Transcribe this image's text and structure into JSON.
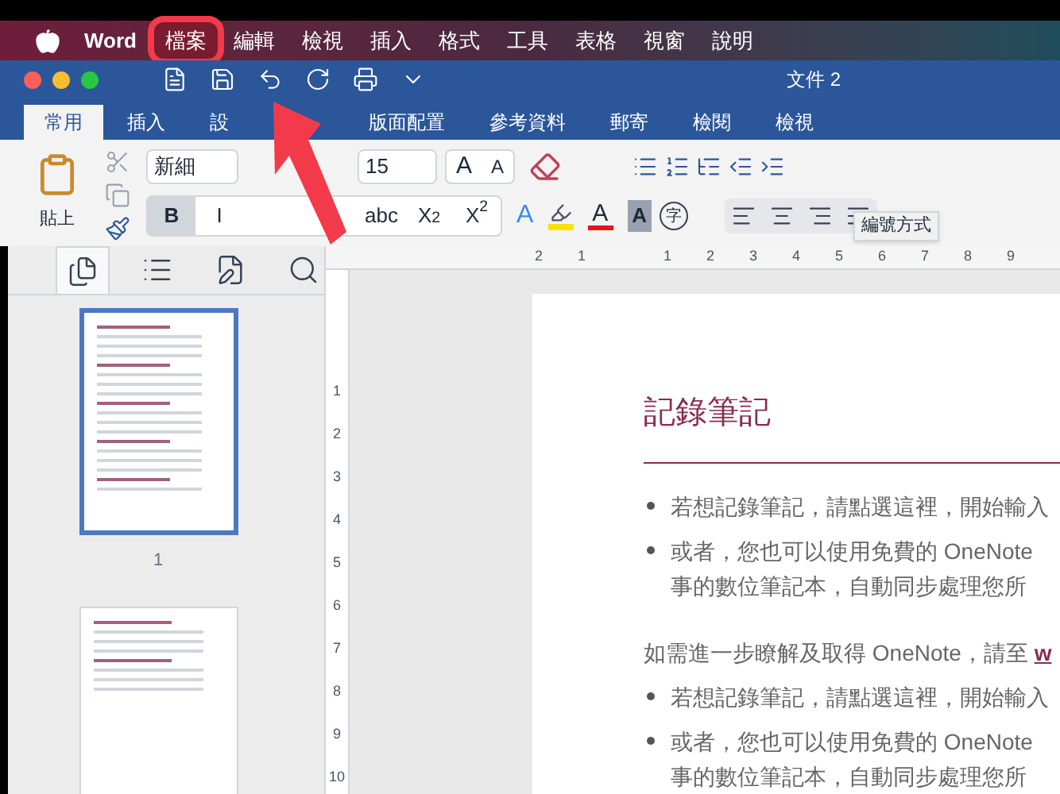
{
  "menu_bar": {
    "app": "Word",
    "items": [
      {
        "label": "檔案",
        "highlighted": true
      },
      {
        "label": "編輯",
        "highlighted": false
      },
      {
        "label": "檢視",
        "highlighted": false
      },
      {
        "label": "插入",
        "highlighted": false
      },
      {
        "label": "格式",
        "highlighted": false
      },
      {
        "label": "工具",
        "highlighted": false
      },
      {
        "label": "表格",
        "highlighted": false
      },
      {
        "label": "視窗",
        "highlighted": false
      },
      {
        "label": "說明",
        "highlighted": false
      }
    ]
  },
  "window": {
    "title": "文件 2"
  },
  "ribbon_tabs": [
    {
      "label": "常用",
      "selected": true
    },
    {
      "label": "插入",
      "selected": false
    },
    {
      "label": "設",
      "selected": false
    },
    {
      "label": "版面配置",
      "selected": false
    },
    {
      "label": "參考資料",
      "selected": false
    },
    {
      "label": "郵寄",
      "selected": false
    },
    {
      "label": "檢閱",
      "selected": false
    },
    {
      "label": "檢視",
      "selected": false
    }
  ],
  "ribbon": {
    "paste_label": "貼上",
    "font_name": "新細",
    "font_size": "15",
    "size_buttons": [
      "A",
      "A"
    ],
    "style_buttons": [
      {
        "label": "B",
        "selected": true
      },
      {
        "label": "I",
        "selected": false
      },
      {
        "label": "abc",
        "selected": false
      },
      {
        "label": "X$_{2}$",
        "selected": false
      },
      {
        "label": "X$^{2}$",
        "selected": false
      }
    ],
    "text_effect": "A",
    "highlighter": {
      "color": "#f5e400"
    },
    "font_color": {
      "label": "A",
      "color": "#e8141c"
    },
    "shading": "A",
    "phonetic": "字",
    "tooltip": "編號方式"
  },
  "sidebar": {
    "tabs": [
      {
        "kind": "pages",
        "selected": true
      },
      {
        "kind": "outline",
        "selected": false
      },
      {
        "kind": "edit",
        "selected": false
      },
      {
        "kind": "search",
        "selected": false
      }
    ],
    "thumbnails": [
      {
        "selected": true,
        "label": "1"
      },
      {
        "selected": false
      }
    ]
  },
  "rulers": {
    "horizontal": [
      "2",
      "1",
      "1",
      "2",
      "3",
      "4",
      "5",
      "6",
      "7",
      "8",
      "9"
    ],
    "vertical": [
      "1",
      "2",
      "3",
      "4",
      "5",
      "6",
      "7",
      "8",
      "9",
      "10"
    ]
  },
  "document": {
    "heading": "記錄筆記",
    "blocks": [
      {
        "kind": "bullet",
        "lines": [
          "若想記錄筆記，請點選這裡，開始輸入"
        ]
      },
      {
        "kind": "bullet",
        "lines": [
          "或者，您也可以使用免費的 OneNote",
          "事的數位筆記本，自動同步處理您所"
        ]
      },
      {
        "kind": "para",
        "text": "如需進一步瞭解及取得 OneNote，請至 ",
        "link": "w"
      },
      {
        "kind": "bullet",
        "lines": [
          "若想記錄筆記，請點選這裡，開始輸入"
        ]
      },
      {
        "kind": "bullet",
        "lines": [
          "或者，您也可以使用免費的 OneNote",
          "事的數位筆記本，自動同步處理您所"
        ]
      }
    ]
  }
}
